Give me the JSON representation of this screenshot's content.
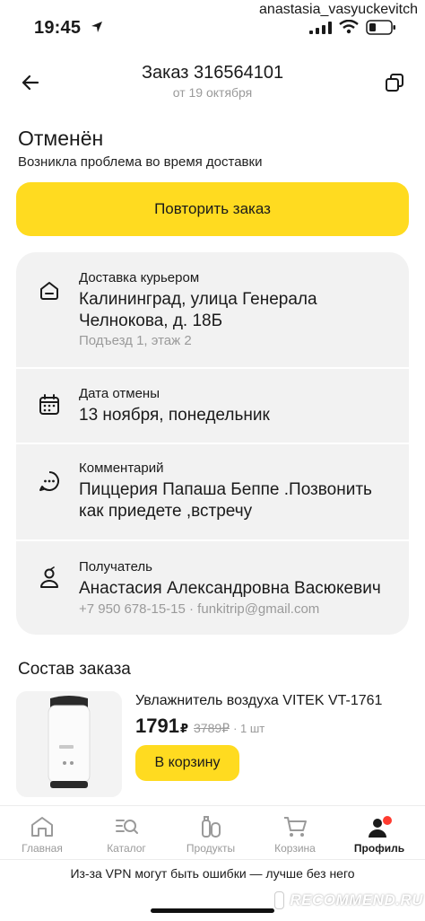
{
  "status_bar": {
    "time": "19:45",
    "username": "anastasia_vasyuckevitch"
  },
  "header": {
    "title": "Заказ 316564101",
    "subtitle": "от 19 октября",
    "back_icon": "arrow-left-icon",
    "copy_icon": "copy-icon"
  },
  "order_status": {
    "title": "Отменён",
    "description": "Возникла проблема во время доставки",
    "repeat_button": "Повторить заказ"
  },
  "info": {
    "delivery": {
      "icon": "home-icon",
      "label": "Доставка курьером",
      "address_line1": "Калининград, улица Генерала",
      "address_line2": "Челнокова, д. 18Б",
      "extra": "Подъезд 1, этаж 2"
    },
    "cancel_date": {
      "icon": "calendar-icon",
      "label": "Дата отмены",
      "value": "13 ноября, понедельник"
    },
    "comment": {
      "icon": "chat-icon",
      "label": "Комментарий",
      "value_line1": "Пиццерия Папаша Беппе .Позвонить",
      "value_line2": "как приедете ,встречу"
    },
    "recipient": {
      "icon": "person-icon",
      "label": "Получатель",
      "name": "Анастасия Александровна Васюкевич",
      "contacts": "+7 950 678-15-15 · funkitrip@gmail.com"
    }
  },
  "order_contents": {
    "title": "Состав заказа",
    "items": [
      {
        "name": "Увлажнитель воздуха VITEK VT-1761",
        "price": "1791",
        "currency": "₽",
        "old_price": "3789₽",
        "quantity": "· 1 шт",
        "cart_button": "В корзину"
      }
    ]
  },
  "tabbar": {
    "tabs": [
      {
        "label": "Главная",
        "icon": "home-tab-icon",
        "active": false
      },
      {
        "label": "Каталог",
        "icon": "catalog-search-icon",
        "active": false
      },
      {
        "label": "Продукты",
        "icon": "products-icon",
        "active": false
      },
      {
        "label": "Корзина",
        "icon": "cart-icon",
        "active": false
      },
      {
        "label": "Профиль",
        "icon": "profile-icon",
        "active": true
      }
    ]
  },
  "vpn_banner": "Из-за VPN могут быть ошибки — лучше без него",
  "watermark": "RECOMMEND.RU",
  "colors": {
    "accent": "#ffdb20",
    "card_bg": "#f2f2f2",
    "muted": "#9a9a9a",
    "notification": "#ff3b30"
  }
}
